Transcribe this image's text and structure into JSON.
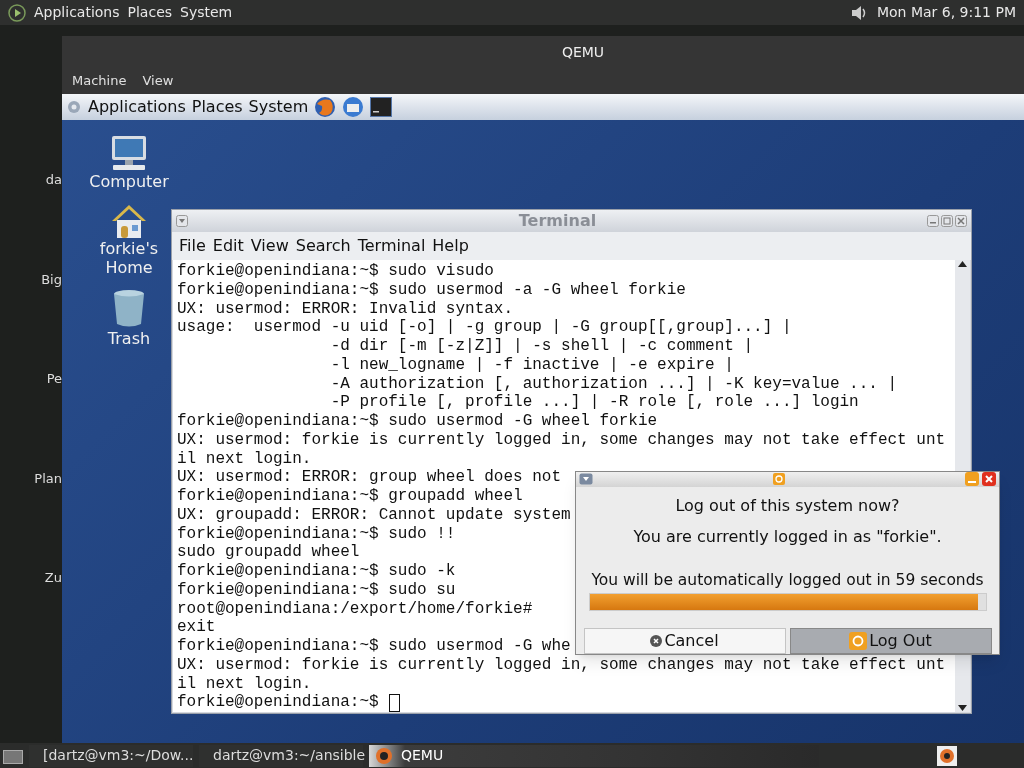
{
  "host_panel": {
    "menus": [
      "Applications",
      "Places",
      "System"
    ],
    "clock": "Mon Mar 6, 9:11 PM"
  },
  "host_desktop_labels": [
    "da",
    "Big",
    "Pe",
    "Plan",
    "Zu"
  ],
  "qemu": {
    "title": "QEMU",
    "menus": [
      "Machine",
      "View"
    ],
    "guest": {
      "panel_menus": [
        "Applications",
        "Places",
        "System"
      ],
      "desktop_icons": [
        {
          "kind": "computer",
          "label": "Computer"
        },
        {
          "kind": "home",
          "label": "forkie's Home"
        },
        {
          "kind": "trash",
          "label": "Trash"
        }
      ],
      "terminal": {
        "title": "Terminal",
        "menus": [
          "File",
          "Edit",
          "View",
          "Search",
          "Terminal",
          "Help"
        ],
        "cursor": true,
        "lines": [
          "forkie@openindiana:~$ sudo visudo",
          "forkie@openindiana:~$ sudo usermod -a -G wheel forkie",
          "UX: usermod: ERROR: Invalid syntax.",
          "usage:  usermod -u uid [-o] | -g group | -G group[[,group]...] |",
          "                -d dir [-m [-z|Z]] | -s shell | -c comment |",
          "                -l new_logname | -f inactive | -e expire |",
          "                -A authorization [, authorization ...] | -K key=value ... |",
          "                -P profile [, profile ...] | -R role [, role ...] login",
          "forkie@openindiana:~$ sudo usermod -G wheel forkie",
          "UX: usermod: forkie is currently logged in, some changes may not take effect unt",
          "il next login.",
          "UX: usermod: ERROR: group wheel does not",
          "forkie@openindiana:~$ groupadd wheel",
          "UX: groupadd: ERROR: Cannot update system",
          "forkie@openindiana:~$ sudo !!",
          "sudo groupadd wheel",
          "forkie@openindiana:~$ sudo -k",
          "forkie@openindiana:~$ sudo su",
          "root@openindiana:/export/home/forkie#",
          "exit",
          "forkie@openindiana:~$ sudo usermod -G whe",
          "UX: usermod: forkie is currently logged in, some changes may not take effect unt",
          "il next login.",
          "forkie@openindiana:~$"
        ]
      },
      "logout_dialog": {
        "heading": "Log out of this system now?",
        "message": "You are currently logged in as \"forkie\".",
        "countdown": "You will be automatically logged out in 59 seconds",
        "level": 0.98,
        "buttons": [
          {
            "kind": "cancel",
            "label": "Cancel",
            "selected": false
          },
          {
            "kind": "logout",
            "label": "Log Out",
            "selected": true
          }
        ]
      }
    }
  },
  "taskbar": {
    "items": [
      {
        "kind": "terminal",
        "label": "[dartz@vm3:~/Dow...",
        "selected": false
      },
      {
        "kind": "terminal",
        "label": "dartz@vm3:~/ansible",
        "selected": false
      },
      {
        "kind": "qemu",
        "label": "QEMU",
        "selected": true
      }
    ]
  }
}
